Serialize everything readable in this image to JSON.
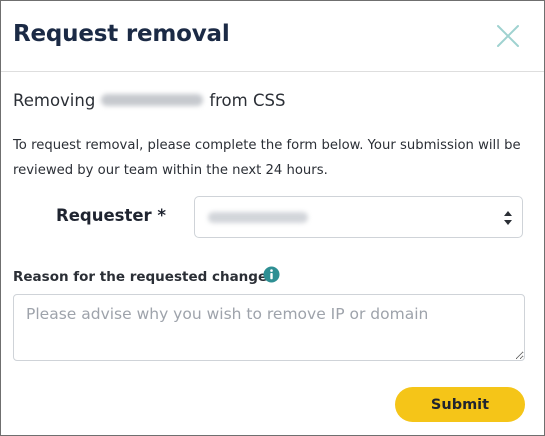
{
  "dialog": {
    "title": "Request removal",
    "close_icon": "close-x-icon"
  },
  "removing": {
    "prefix": "Removing",
    "suffix": "from CSS"
  },
  "description": "To request removal, please complete the form below. Your submission will be reviewed by our team within the next 24 hours.",
  "requester": {
    "label": "Requester *",
    "arrow_icon": "select-arrows-icon"
  },
  "reason": {
    "label": "Reason for the requested change",
    "info_icon": "info-icon",
    "placeholder": "Please advise why you wish to remove IP or domain",
    "value": ""
  },
  "submit": {
    "label": "Submit"
  },
  "colors": {
    "title": "#1b2a45",
    "close": "#9fd2d0",
    "info": "#2e8f93",
    "submit_bg": "#f5c518"
  }
}
